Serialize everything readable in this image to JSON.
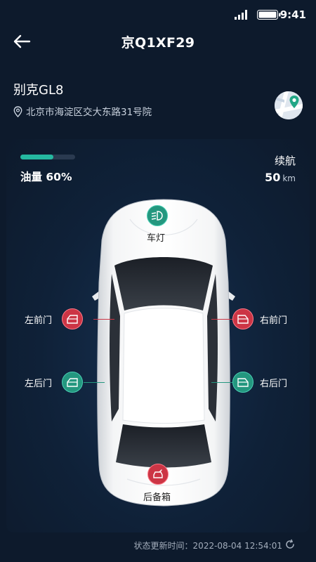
{
  "status_bar": {
    "time": "9:41"
  },
  "header": {
    "title": "京Q1XF29"
  },
  "vehicle": {
    "name": "别克GL8",
    "address": "北京市海淀区交大东路31号院"
  },
  "fuel": {
    "label": "油量 60%",
    "level": 0.6
  },
  "range": {
    "label": "续航",
    "value": "50",
    "unit": "km"
  },
  "controls": {
    "light": "车灯",
    "front_left": "左前门",
    "front_right": "右前门",
    "rear_left": "左后门",
    "rear_right": "右后门",
    "trunk": "后备箱"
  },
  "footer": {
    "label": "状态更新时间：",
    "time": "2022-08-04 12:54:01"
  },
  "colors": {
    "background": "#0d1a2c",
    "accent": "#25b8a0",
    "alert": "#cc3545"
  },
  "icons": [
    "signal-icon",
    "battery-icon",
    "back-arrow-icon",
    "location-pin-icon",
    "map-icon",
    "headlight-icon",
    "door-icon",
    "trunk-icon",
    "refresh-icon"
  ]
}
